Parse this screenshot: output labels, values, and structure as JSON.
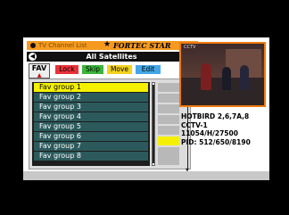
{
  "header": {
    "title": "TV Channel List",
    "brand": "FORTEC STAR"
  },
  "satellite": {
    "label": "All Satellites"
  },
  "mode_tab": {
    "label": "FAV"
  },
  "buttons": {
    "lock": "Lock",
    "skip": "Skip",
    "move": "Move",
    "edit": "Edit"
  },
  "groups": [
    "Fav group 1",
    "Fav group 2",
    "Fav group 3",
    "Fav group 4",
    "Fav group 5",
    "Fav group 6",
    "Fav group 7",
    "Fav group 8"
  ],
  "selected_group_index": 0,
  "preview": {
    "overlay": "CCTV"
  },
  "channel_info": {
    "satellite": "HOTBIRD 2,6,7A,8",
    "channel": "CCTV-1",
    "transponder": "11054/H/27500",
    "pid": "PID:  512/650/8190"
  },
  "colors": {
    "lock": "#e8323a",
    "skip": "#3cb43c",
    "move": "#f2d21e",
    "edit": "#43a6e6",
    "accent": "#f59a1e"
  }
}
